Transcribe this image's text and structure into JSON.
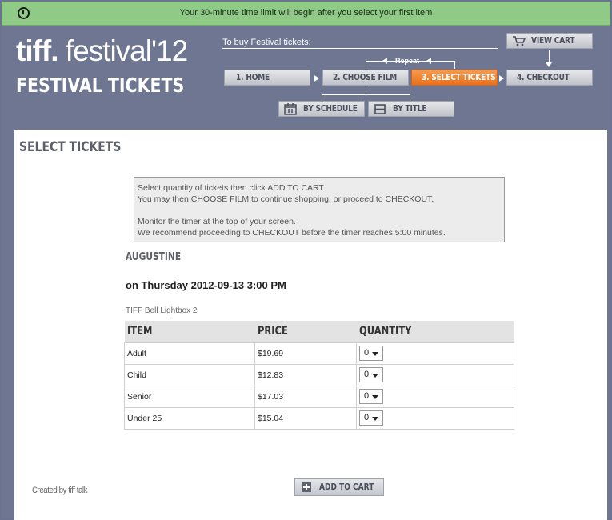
{
  "timer": {
    "message": "Your 30-minute time limit will begin after you select your first item"
  },
  "header": {
    "logo_tiff": "tiff.",
    "logo_rest": " festival'12",
    "subtitle": "FESTIVAL TICKETS",
    "buy_label": "To buy Festival tickets:",
    "repeat_label": "Repeat",
    "view_cart": "VIEW CART",
    "steps": [
      {
        "label": "1.  HOME"
      },
      {
        "label": "2.  CHOOSE FILM"
      },
      {
        "label": "3.  SELECT TICKETS"
      },
      {
        "label": "4.  CHECKOUT"
      }
    ],
    "sub_options": [
      {
        "label": "BY SCHEDULE"
      },
      {
        "label": "BY TITLE"
      }
    ]
  },
  "main": {
    "title": "SELECT TICKETS",
    "notice": {
      "line1": "Select quantity of tickets then click ADD TO CART.",
      "line2": "You may then CHOOSE FILM to continue shopping, or proceed to CHECKOUT.",
      "line3": "Monitor the timer at the top of your screen.",
      "line4": "We recommend proceeding to CHECKOUT before the timer reaches 5:00 minutes."
    },
    "film_title": "AUGUSTINE",
    "showtime": "on Thursday 2012-09-13 3:00 PM",
    "venue": "TIFF Bell Lightbox 2",
    "table": {
      "headers": [
        "ITEM",
        "PRICE",
        "QUANTITY"
      ],
      "rows": [
        {
          "item": "Adult",
          "price": "$19.69",
          "qty": "0"
        },
        {
          "item": "Child",
          "price": "$12.83",
          "qty": "0"
        },
        {
          "item": "Senior",
          "price": "$17.03",
          "qty": "0"
        },
        {
          "item": "Under 25",
          "price": "$15.04",
          "qty": "0"
        }
      ]
    },
    "add_to_cart": "ADD TO CART",
    "credit": "Created by tiff talk"
  },
  "colors": {
    "timer_bar": "#8fca86",
    "header_bg": "#6e7691",
    "active_step": "#f08a3a"
  }
}
